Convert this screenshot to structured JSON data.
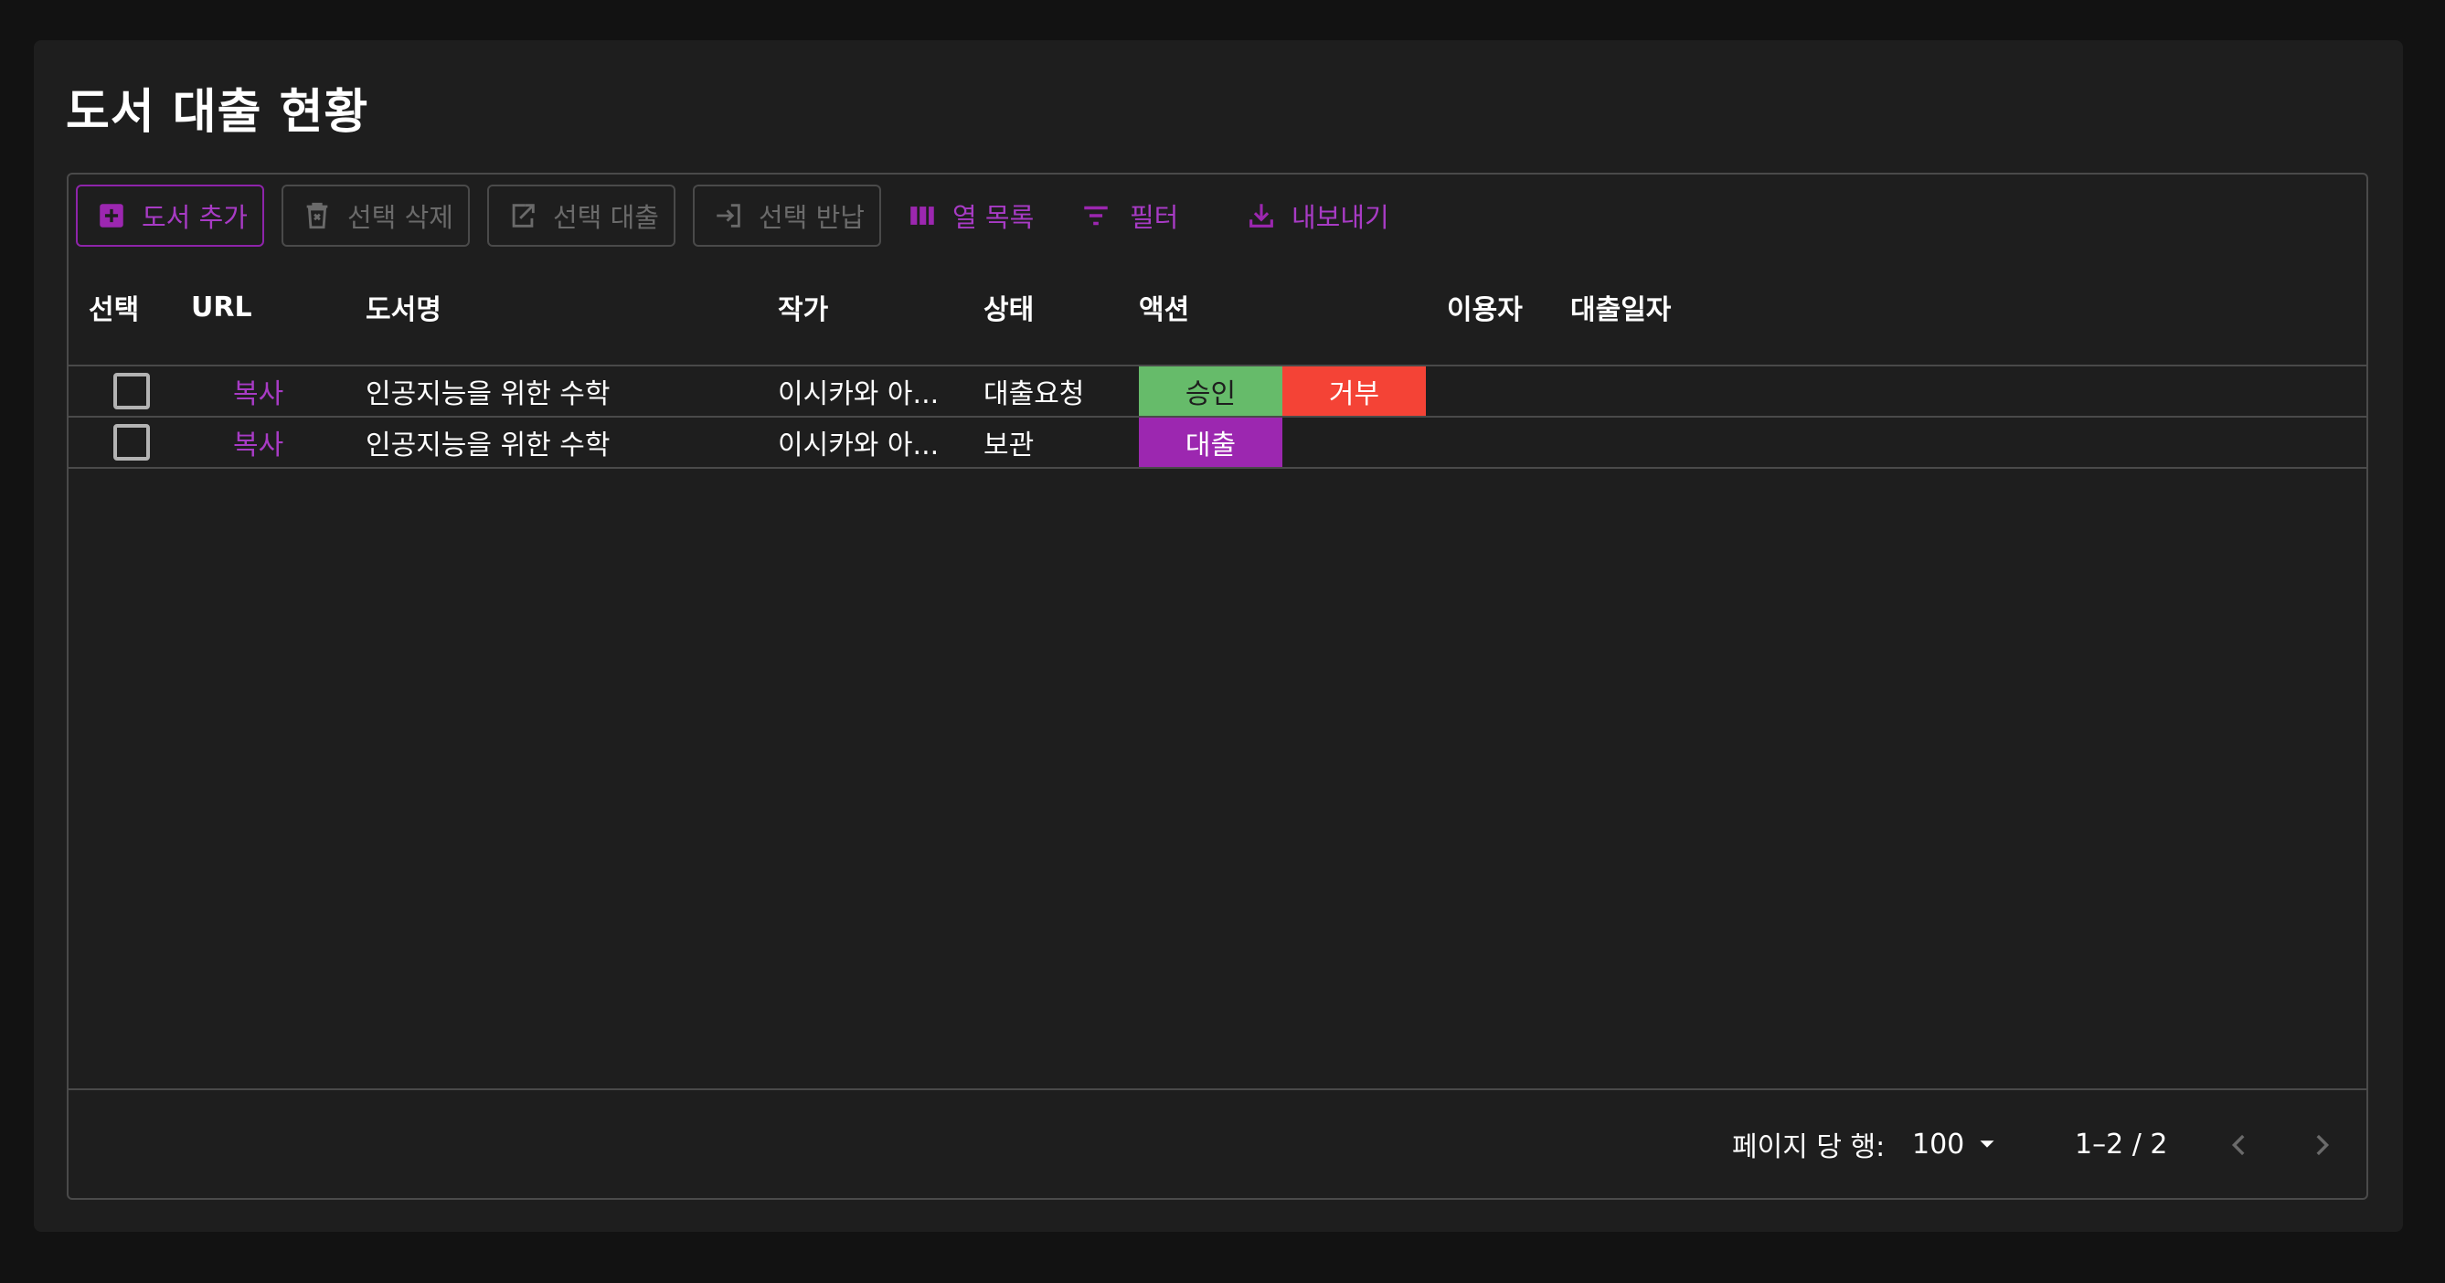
{
  "page": {
    "title": "도서 대출 현황"
  },
  "toolbar": {
    "add_label": "도서 추가",
    "delete_label": "선택 삭제",
    "loan_label": "선택 대출",
    "return_label": "선택 반납",
    "columns_label": "열 목록",
    "filter_label": "필터",
    "export_label": "내보내기",
    "icons": [
      "add-box-icon",
      "delete-icon",
      "export-box-icon",
      "login-icon",
      "view-column-icon",
      "filter-list-icon",
      "download-icon"
    ]
  },
  "table": {
    "columns": [
      "선택",
      "URL",
      "도서명",
      "작가",
      "상태",
      "액션",
      "이용자",
      "대출일자"
    ],
    "rows": [
      {
        "checked": false,
        "url": "복사",
        "title": "인공지능을 위한 수학",
        "author": "이시카와 아...",
        "status": "대출요청",
        "actions": [
          {
            "label": "승인",
            "color": "#66bb6a"
          },
          {
            "label": "거부",
            "color": "#f44336"
          }
        ],
        "user": "",
        "loan_date": ""
      },
      {
        "checked": false,
        "url": "복사",
        "title": "인공지능을 위한 수학",
        "author": "이시카와 아...",
        "status": "보관",
        "actions": [
          {
            "label": "대출",
            "color": "#9c27b0"
          }
        ],
        "user": "",
        "loan_date": ""
      }
    ]
  },
  "pagination": {
    "rows_per_page_label": "페이지 당 행:",
    "rows_per_page_value": "100",
    "range_label": "1–2 / 2"
  },
  "colors": {
    "accent": "#a83bc5",
    "background": "#121212",
    "surface": "#1e1e1e",
    "border": "#4a4a4a"
  }
}
